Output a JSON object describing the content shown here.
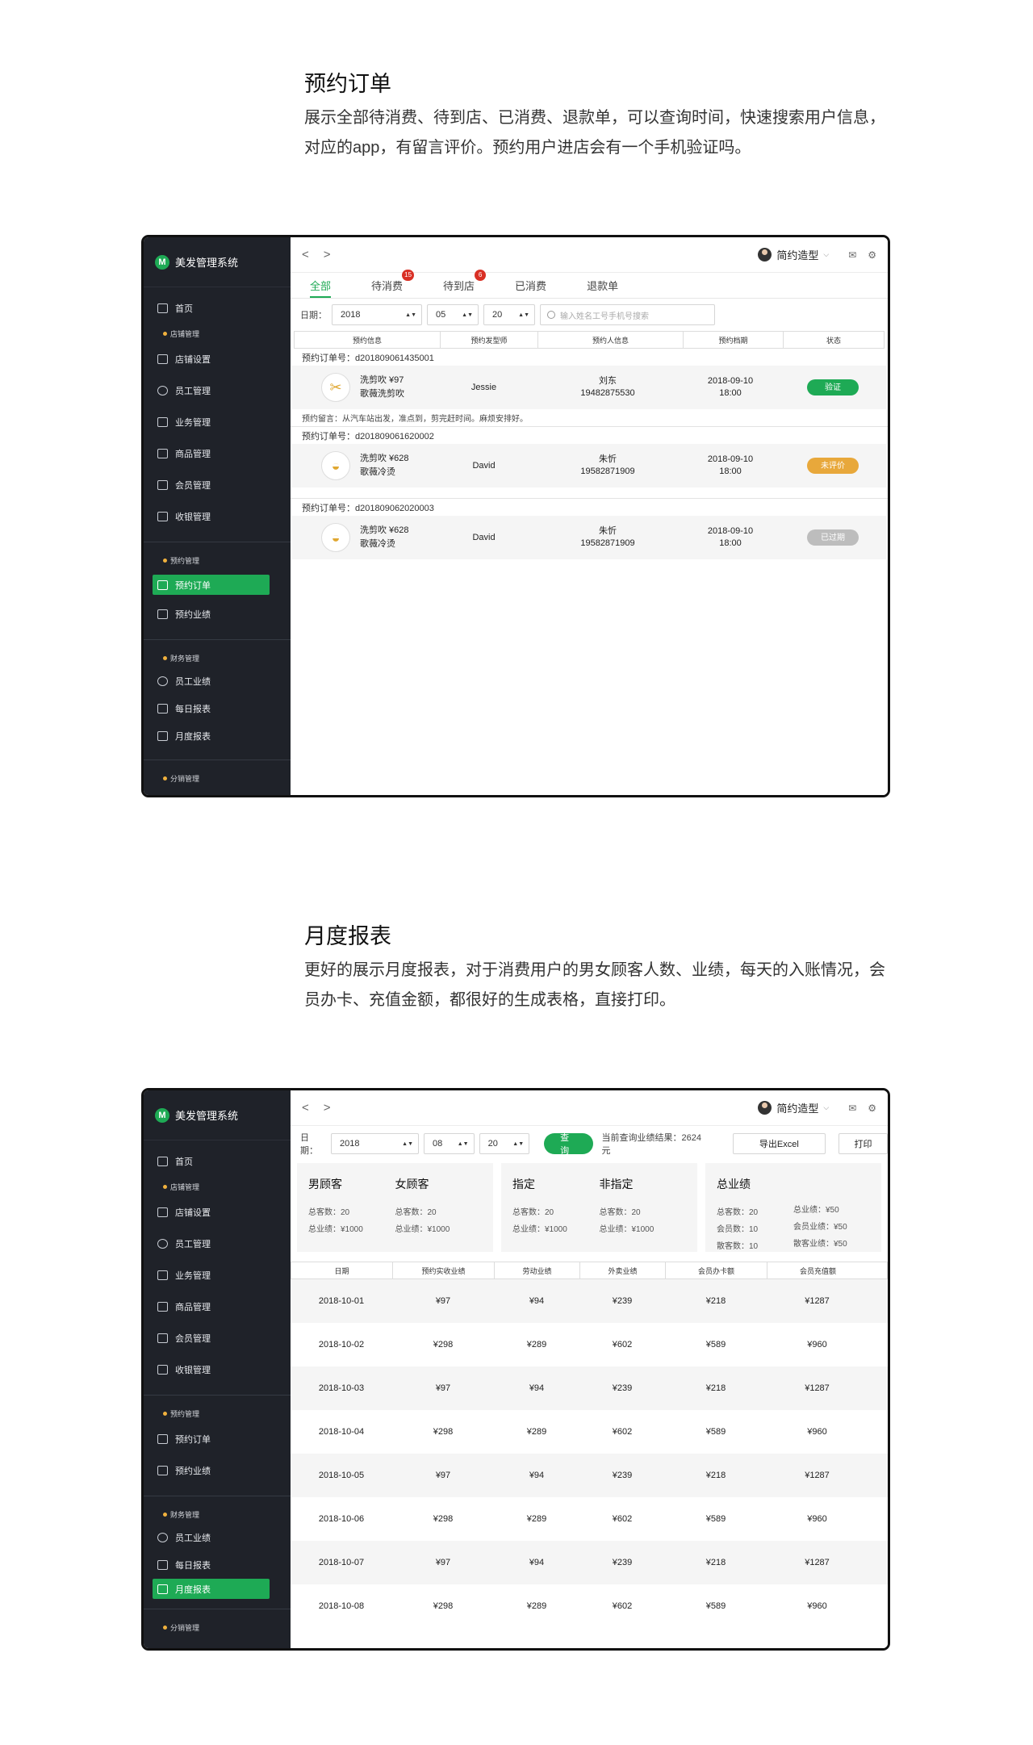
{
  "section1": {
    "title": "预约订单",
    "desc_line1": "展示全部待消费、待到店、已消费、退款单，可以查询时间，快速搜索用户信息，",
    "desc_line2": "对应的app，有留言评价。预约用户进店会有一个手机验证吗。"
  },
  "section2": {
    "title": "月度报表",
    "desc_line1": "更好的展示月度报表，对于消费用户的男女顾客人数、业绩，每天的入账情况，会",
    "desc_line2": "员办卡、充值金额，都很好的生成表格，直接打印。"
  },
  "app": {
    "logo_text": "美发管理系统",
    "user_name": "简约造型",
    "nav_prev": "<",
    "nav_next": ">"
  },
  "sidebar": {
    "home": "首页",
    "group_store": "店铺管理",
    "store_settings": "店铺设置",
    "staff": "员工管理",
    "business": "业务管理",
    "goods": "商品管理",
    "members": "会员管理",
    "cashier": "收银管理",
    "group_booking": "预约管理",
    "booking_orders": "预约订单",
    "booking_perf": "预约业绩",
    "group_finance": "财务管理",
    "staff_perf": "员工业绩",
    "daily_report": "每日报表",
    "monthly_report": "月度报表",
    "group_distribution": "分销管理"
  },
  "orders": {
    "tabs": [
      {
        "label": "全部"
      },
      {
        "label": "待消费",
        "badge": "15"
      },
      {
        "label": "待到店",
        "badge": "6"
      },
      {
        "label": "已消费"
      },
      {
        "label": "退款单"
      }
    ],
    "date_label": "日期：",
    "year": "2018",
    "month": "05",
    "day": "20",
    "search_placeholder": "输入姓名工号手机号搜索",
    "columns": [
      "预约信息",
      "预约发型师",
      "预约人信息",
      "预约档期",
      "状态"
    ],
    "rows": [
      {
        "order_no": "预约订单号：d201809061435001",
        "service": "洗剪吹 ¥97",
        "sub": "歌薇洗剪吹",
        "stylist": "Jessie",
        "customer": "刘东",
        "phone": "19482875530",
        "date": "2018-09-10",
        "time": "18:00",
        "status": "验证",
        "note": "预约留言：从汽车站出发，准点到，剪完赶时间。麻烦安排好。"
      },
      {
        "order_no": "预约订单号：d201809061620002",
        "service": "洗剪吹 ¥628",
        "sub": "歌薇冷烫",
        "stylist": "David",
        "customer": "朱忻",
        "phone": "19582871909",
        "date": "2018-09-10",
        "time": "18:00",
        "status": "未评价"
      },
      {
        "order_no": "预约订单号：d201809062020003",
        "service": "洗剪吹 ¥628",
        "sub": "歌薇冷烫",
        "stylist": "David",
        "customer": "朱忻",
        "phone": "19582871909",
        "date": "2018-09-10",
        "time": "18:00",
        "status": "已过期"
      }
    ]
  },
  "report": {
    "date_label": "日期：",
    "year": "2018",
    "month": "08",
    "day": "20",
    "query_btn": "查询",
    "summary": "当前查询业绩结果：2624元",
    "export_btn": "导出Excel",
    "print_btn": "打印",
    "cards": [
      {
        "cols": [
          {
            "h": "男顾客",
            "l1": "总客数：20",
            "l2": "总业绩：¥1000"
          },
          {
            "h": "女顾客",
            "l1": "总客数：20",
            "l2": "总业绩：¥1000"
          }
        ]
      },
      {
        "cols": [
          {
            "h": "指定",
            "l1": "总客数：20",
            "l2": "总业绩：¥1000"
          },
          {
            "h": "非指定",
            "l1": "总客数：20",
            "l2": "总业绩：¥1000"
          }
        ]
      },
      {
        "cols": [
          {
            "h": "总业绩",
            "l1": "总客数：20",
            "l2": "会员数：10",
            "l3": "散客数：10"
          },
          {
            "h": "",
            "l1": "总业绩：¥50",
            "l2": "会员业绩：¥50",
            "l3": "散客业绩：¥50"
          }
        ]
      }
    ],
    "columns": [
      "日期",
      "预约实收业绩",
      "劳动业绩",
      "外卖业绩",
      "会员办卡额",
      "会员充值额"
    ],
    "rows": [
      [
        "2018-10-01",
        "¥97",
        "¥94",
        "¥239",
        "¥218",
        "¥1287"
      ],
      [
        "2018-10-02",
        "¥298",
        "¥289",
        "¥602",
        "¥589",
        "¥960"
      ],
      [
        "2018-10-03",
        "¥97",
        "¥94",
        "¥239",
        "¥218",
        "¥1287"
      ],
      [
        "2018-10-04",
        "¥298",
        "¥289",
        "¥602",
        "¥589",
        "¥960"
      ],
      [
        "2018-10-05",
        "¥97",
        "¥94",
        "¥239",
        "¥218",
        "¥1287"
      ],
      [
        "2018-10-06",
        "¥298",
        "¥289",
        "¥602",
        "¥589",
        "¥960"
      ],
      [
        "2018-10-07",
        "¥97",
        "¥94",
        "¥239",
        "¥218",
        "¥1287"
      ],
      [
        "2018-10-08",
        "¥298",
        "¥289",
        "¥602",
        "¥589",
        "¥960"
      ]
    ]
  },
  "colors": {
    "accent": "#1eaa55",
    "sidebar_bg": "#1f2229",
    "status_verify": "#1eaa55",
    "status_unrated": "#e8a83b",
    "status_expired": "#bdbdbd",
    "badge": "#d93025"
  }
}
